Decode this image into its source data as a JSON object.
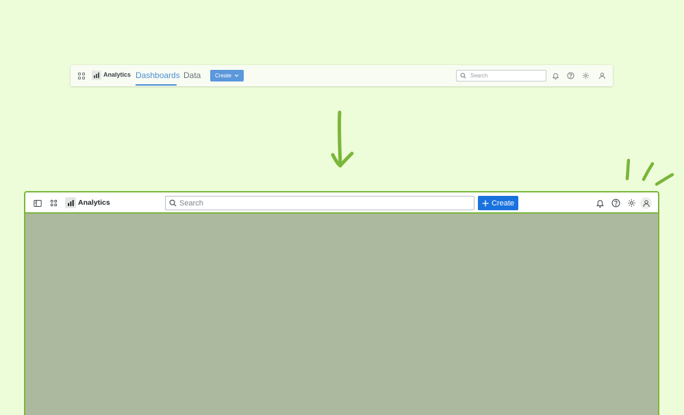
{
  "old_nav": {
    "brand": "Analytics",
    "tabs": [
      {
        "label": "Dashboards",
        "active": true
      },
      {
        "label": "Data",
        "active": false
      }
    ],
    "create_label": "Create",
    "search_placeholder": "Search",
    "icons": [
      "apps-grid-icon",
      "analytics-logo-icon",
      "chevron-down-icon",
      "search-icon",
      "bell-icon",
      "help-icon",
      "gear-icon",
      "user-icon"
    ]
  },
  "new_nav": {
    "brand": "Analytics",
    "search_placeholder": "Search",
    "create_label": "Create",
    "icons": [
      "sidebar-panel-icon",
      "apps-grid-icon",
      "analytics-logo-icon",
      "search-icon",
      "plus-icon",
      "bell-icon",
      "help-icon",
      "gear-icon",
      "user-icon"
    ]
  },
  "colors": {
    "background": "#eefdd9",
    "annotation_green": "#7ab63a",
    "old_accent": "#4a8fd6",
    "old_create": "#5b97db",
    "new_create": "#1a72de",
    "content_area": "#adb99e"
  }
}
